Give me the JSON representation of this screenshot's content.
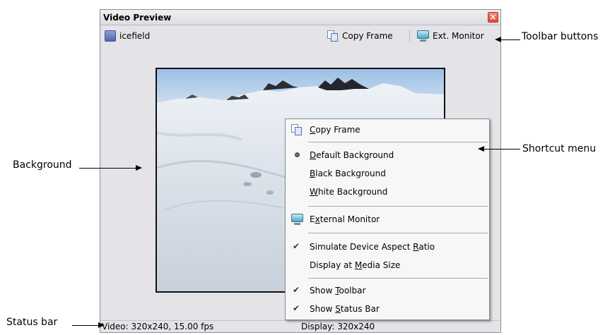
{
  "window": {
    "title": "Video Preview",
    "close_glyph": "×"
  },
  "toolbar": {
    "media_name": "icefield",
    "copy_frame": "Copy Frame",
    "ext_monitor": "Ext. Monitor"
  },
  "status": {
    "video": "Video: 320x240, 15.00 fps",
    "display": "Display: 320x240"
  },
  "menu": {
    "items": [
      {
        "pre": "",
        "key": "C",
        "post": "opy Frame",
        "icon": "copy-icon"
      },
      {
        "pre": "",
        "key": "D",
        "post": "efault Background",
        "mark": "radio"
      },
      {
        "pre": "",
        "key": "B",
        "post": "lack Background"
      },
      {
        "pre": "",
        "key": "W",
        "post": "hite Background"
      },
      {
        "pre": "E",
        "key": "x",
        "post": "ternal Monitor",
        "icon": "monitor-icon"
      },
      {
        "pre": "Simulate Device Aspect ",
        "key": "R",
        "post": "atio",
        "mark": "check"
      },
      {
        "pre": "Display at ",
        "key": "M",
        "post": "edia Size"
      },
      {
        "pre": "Show ",
        "key": "T",
        "post": "oolbar",
        "mark": "check"
      },
      {
        "pre": "Show ",
        "key": "S",
        "post": "tatus Bar",
        "mark": "check"
      }
    ],
    "check_glyph": "✔"
  },
  "callouts": {
    "toolbar_buttons": "Toolbar buttons",
    "shortcut_menu": "Shortcut menu",
    "background": "Background",
    "status_bar": "Status bar"
  }
}
